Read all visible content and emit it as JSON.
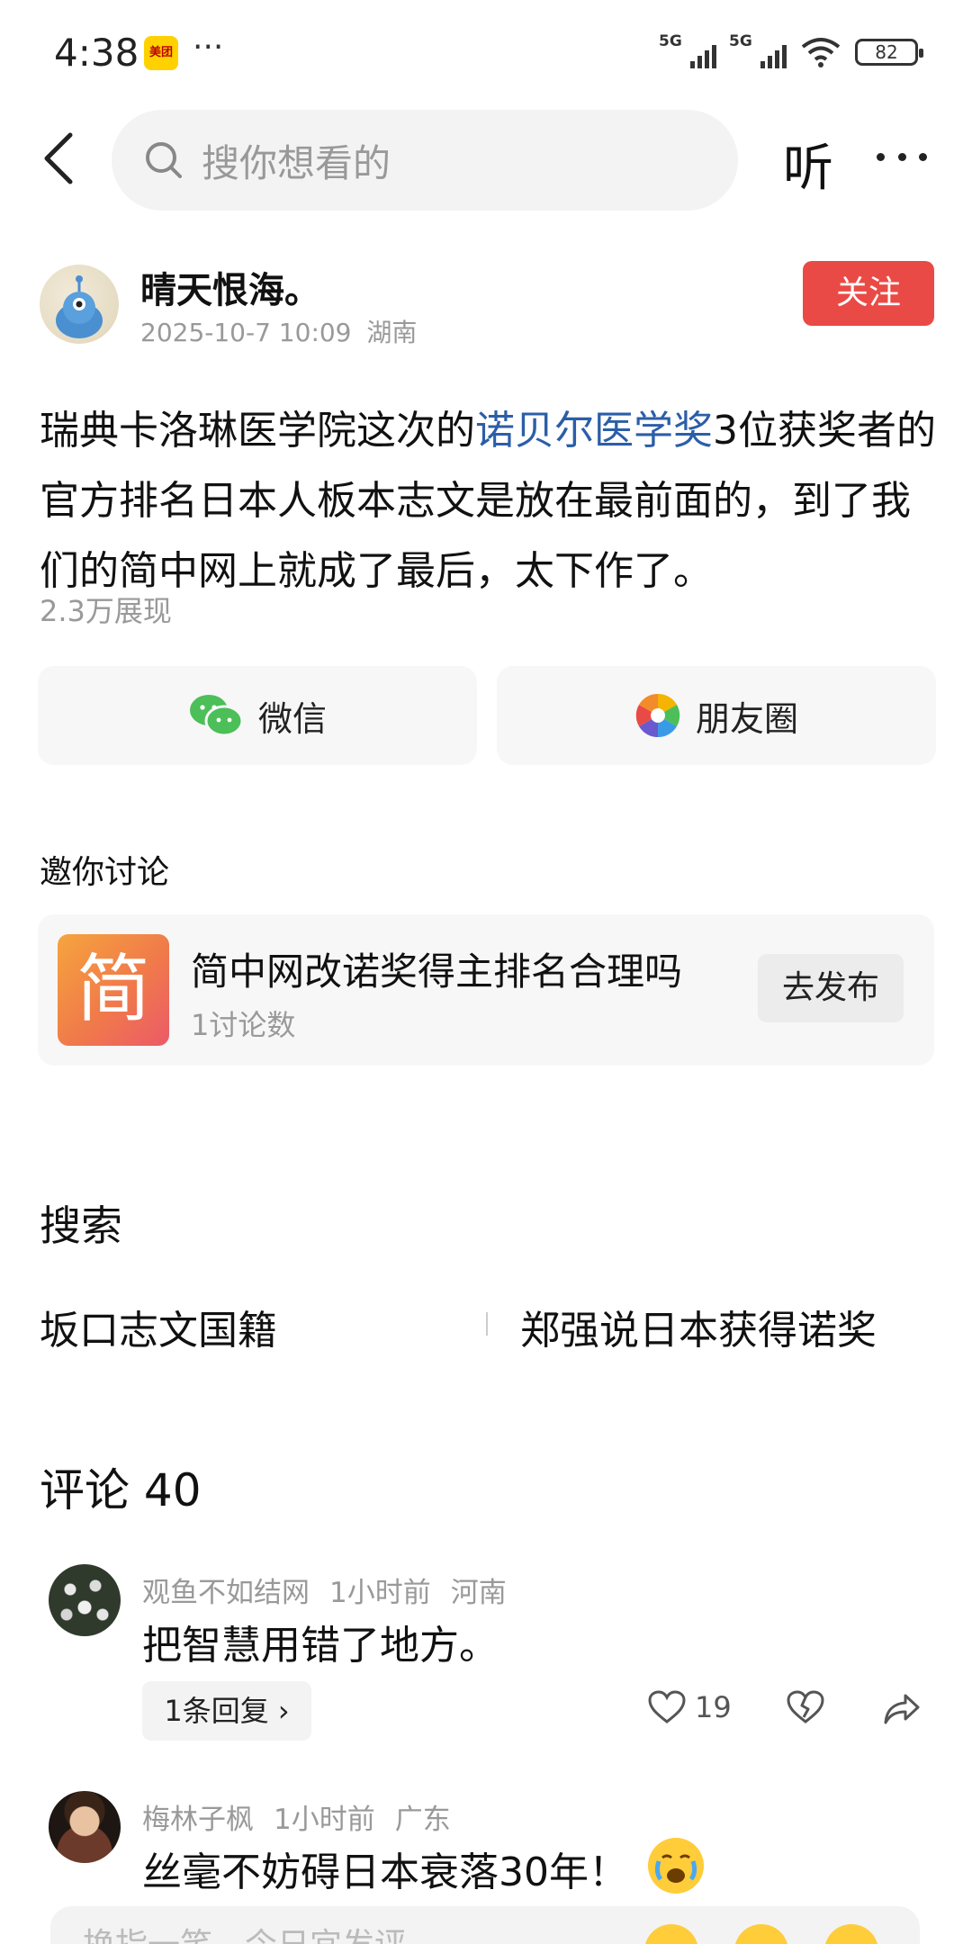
{
  "status_bar": {
    "time": "4:38",
    "app_icon_text": "美团",
    "more": "···",
    "network1": "5G",
    "network2": "5G",
    "battery": "82"
  },
  "nav": {
    "search_placeholder": "搜你想看的",
    "listen_label": "听"
  },
  "author": {
    "name": "晴天恨海。",
    "datetime": "2025-10-7 10:09",
    "location": "湖南",
    "follow_label": "关注"
  },
  "post": {
    "text_before": "瑞典卡洛琳医学院这次的",
    "link_text": "诺贝尔医学奖",
    "text_after": "3位获奖者的官方排名日本人板本志文是放在最前面的，到了我们的简中网上就成了最后，太下作了。",
    "views": "2.3万展现"
  },
  "share": {
    "wechat_label": "微信",
    "moments_label": "朋友圈"
  },
  "discussion": {
    "section_title": "邀你讨论",
    "thumb_char": "简",
    "title": "简中网改诺奖得主排名合理吗",
    "count": "1讨论数",
    "post_label": "去发布"
  },
  "search_section": {
    "title": "搜索",
    "terms": [
      "坂口志文国籍",
      "郑强说日本获得诺奖"
    ]
  },
  "comments": {
    "title": "评论 40",
    "items": [
      {
        "user": "观鱼不如结网",
        "time": "1小时前",
        "location": "河南",
        "text": "把智慧用错了地方。",
        "reply_label": "1条回复 ›",
        "likes": "19"
      },
      {
        "user": "梅林子枫",
        "time": "1小时前",
        "location": "广东",
        "text": "丝毫不妨碍日本衰落30年！"
      }
    ]
  },
  "input_bar": {
    "placeholder": "换指一笑，今日宜发评"
  },
  "colors": {
    "follow": "#ea4a45",
    "link": "#2b5ea8",
    "wechat_green": "#4cbf58"
  }
}
